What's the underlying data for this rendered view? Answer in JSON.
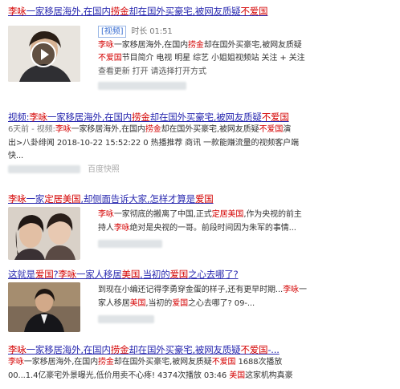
{
  "results": [
    {
      "title_a": "李咏",
      "title_b": "一家移居海外,在国内",
      "title_c": "捞金",
      "title_d": "却在国外买豪宅,被网友质疑",
      "title_e": "不爱国",
      "tag": "[视频]",
      "duration": "时长 01:51",
      "snip1_a": "李咏",
      "snip1_b": "一家移居海外,在国内",
      "snip1_c": "捞金",
      "snip1_d": "却在国外买豪宅,被网友质疑",
      "snip2_a": "不爱国",
      "snip2_b": "节目简介 电视 明星 综艺 小姐姐视频站 关注 + 关注",
      "snip3": "查看更新 打开 请选择打开方式"
    },
    {
      "title_a": "视频:",
      "title_b": "李咏",
      "title_c": "一家移居海外,在国内",
      "title_d": "捞金",
      "title_e": "却在国外买豪宅,被网友质疑",
      "title_f": "不爱国",
      "line1_a": "6天前 - 视频:",
      "line1_b": "李咏",
      "line1_c": "一家移居海外,在国内",
      "line1_d": "捞金",
      "line1_e": "却在国外买豪宅,被网友质疑",
      "line1_f": "不爱国",
      "line1_g": "演",
      "line2": "出>八卦绯闻 2018-10-22 15:52:22 0 热播推荐 商讯 一款能赚流量的视频客户端",
      "line3": "快...",
      "line4": "百度快照"
    },
    {
      "title_a": "李咏",
      "title_b": "一家",
      "title_c": "定居美国",
      "title_d": ",却侧面告诉大家,怎样才算是",
      "title_e": "爱国",
      "snip1_a": "李咏",
      "snip1_b": "一家彻底的搬离了中国,正式",
      "snip1_c": "定居美国",
      "snip1_d": ",作为央视的前主",
      "snip2_a": "持人",
      "snip2_b": "李咏",
      "snip2_c": "绝对是央视的一哥。前段时间因为朱军的事情..."
    },
    {
      "title_a": "这就是",
      "title_b": "爱国",
      "title_c": "?",
      "title_d": "李咏",
      "title_e": "一家人移居",
      "title_f": "美国",
      "title_g": ",当初的",
      "title_h": "爱国",
      "title_i": "之心去哪了?",
      "snip1_a": "到现在小编还记得李勇穿金蛋的样子,还有更早时期...",
      "snip1_b": "李咏",
      "snip1_c": "一",
      "snip2_a": "家人移居",
      "snip2_b": "美国",
      "snip2_c": ",当初的",
      "snip2_d": "爱国",
      "snip2_e": "之心去哪了? 09-..."
    },
    {
      "title_a": "李咏",
      "title_b": "一家移居海外,在国内",
      "title_c": "捞金",
      "title_d": "却在国外买豪宅,被网友质疑",
      "title_e": "不爱国",
      "title_f": "-...",
      "snip1_a": "李咏",
      "snip1_b": "一家移居海外,在国内",
      "snip1_c": "捞金",
      "snip1_d": "却在国外买豪宅,被网友质疑",
      "snip1_e": "不爱国",
      "snip1_f": " 1688次播放",
      "snip2_a": "00...1.4亿豪宅外景曝光,低价用卖不心疼! 4374次播放 03:46 ",
      "snip2_b": "美国",
      "snip2_c": "这家机构真豪"
    }
  ]
}
